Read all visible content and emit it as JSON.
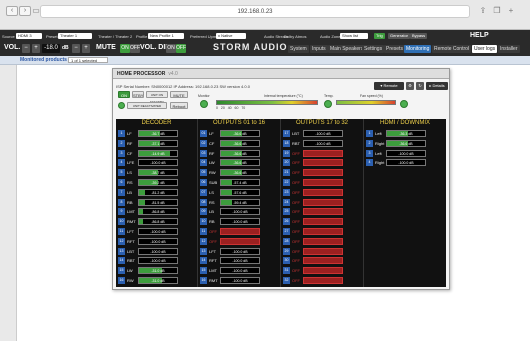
{
  "browser": {
    "url": "192.168.0.23"
  },
  "appbar": {
    "source_label": "Source",
    "source_value": "HDMI 3",
    "preset_label": "Preset",
    "preset_value": "Theater 1",
    "theater_value": "Theater / Theater 2",
    "profile_label": "Profile",
    "profile_value": "New Profile 1",
    "upmix_label": "Preferred Upmix",
    "upmix_value": "x Native",
    "audio_stream_label": "Audio Stream",
    "audio_stream_value": "Dolby Atmos",
    "audio_zones_label": "Audio Zones",
    "audio_zones_value": "Show list",
    "tag_trig": "Trig",
    "tag_generator": "Generator",
    "tag_bypass": "Bypass",
    "help": "HELP",
    "vol_label": "VOL.",
    "vol_minus": "−",
    "vol_plus": "+",
    "vol_value": "-18.0",
    "vol_unit": "dB",
    "mute_label": "MUTE",
    "mute_state": "ON",
    "mute_off": "OFF",
    "voldim_label": "VOL. DIM",
    "voldim_on": "ON",
    "voldim_off": "OFF",
    "logo": "STORM AUDIO",
    "tabs": [
      "System",
      "Inputs",
      "Main Speakers",
      "Settings",
      "Presets",
      "Monitoring",
      "Remote Control",
      "User logs",
      "Installer"
    ],
    "active_tab": "Monitoring"
  },
  "subbar": {
    "title": "Monitored products",
    "selector": "1 of 1 selected"
  },
  "panel": {
    "title": "HOME PROCESSOR",
    "version": "v4.0",
    "info": "ISP   Serial Number: SN0000012   IP Address: 192.168.0.23   SW version 4.0.0",
    "on": "ON",
    "stby": "STBY",
    "unit_on_standby": "UNIT ON STANDBY",
    "mute": "MUTE",
    "unit_deactivated": "UNIT DEACTIVATED",
    "reboot": "Reboot",
    "monitor_label": "Monitor",
    "temp_label": "Internal temperature (°C)",
    "temp_scale": [
      "0",
      "20",
      "40",
      "60",
      "70"
    ],
    "temp_status": "Temp.",
    "fan_label": "Fan speed (%)",
    "remote_value": "Remote",
    "btn_details": "Details"
  },
  "decoder": {
    "title": "DECODER",
    "channels": [
      {
        "n": "1",
        "name": "LF",
        "val": "-36.7 dB",
        "fill": 0.55,
        "on": true
      },
      {
        "n": "2",
        "name": "RF",
        "val": "-37.1 dB",
        "fill": 0.55,
        "on": true
      },
      {
        "n": "3",
        "name": "CF",
        "val": "-14.9 dB",
        "fill": 0.82,
        "on": true
      },
      {
        "n": "4",
        "name": "LFE",
        "val": "-100.0 dB",
        "fill": 0,
        "on": true
      },
      {
        "n": "5",
        "name": "LS",
        "val": "-38.7 dB",
        "fill": 0.5,
        "on": true
      },
      {
        "n": "6",
        "name": "RS",
        "val": "-39.2 dB",
        "fill": 0.5,
        "on": true
      },
      {
        "n": "7",
        "name": "LB",
        "val": "-81.2 dB",
        "fill": 0.15,
        "on": true
      },
      {
        "n": "8",
        "name": "RB",
        "val": "-81.5 dB",
        "fill": 0.15,
        "on": true
      },
      {
        "n": "9",
        "name": "LMT",
        "val": "-86.8 dB",
        "fill": 0.1,
        "on": true
      },
      {
        "n": "10",
        "name": "RMT",
        "val": "-86.8 dB",
        "fill": 0.1,
        "on": true
      },
      {
        "n": "11",
        "name": "LFT",
        "val": "-100.0 dB",
        "fill": 0,
        "on": true
      },
      {
        "n": "12",
        "name": "RFT",
        "val": "-100.0 dB",
        "fill": 0,
        "on": true
      },
      {
        "n": "13",
        "name": "LBT",
        "val": "-100.0 dB",
        "fill": 0,
        "on": true
      },
      {
        "n": "14",
        "name": "RBT",
        "val": "-100.0 dB",
        "fill": 0,
        "on": true
      },
      {
        "n": "15",
        "name": "LW",
        "val": "-31.0 dB",
        "fill": 0.6,
        "on": true
      },
      {
        "n": "16",
        "name": "RW",
        "val": "-31.0 dB",
        "fill": 0.6,
        "on": true
      }
    ]
  },
  "out1": {
    "title": "OUTPUTS 01 to 16",
    "channels": [
      {
        "n": "01",
        "name": "LF",
        "val": "-36.6 dB",
        "fill": 0.55,
        "on": true
      },
      {
        "n": "02",
        "name": "CF",
        "val": "-36.6 dB",
        "fill": 0.55,
        "on": true
      },
      {
        "n": "03",
        "name": "RF",
        "val": "-36.6 dB",
        "fill": 0.55,
        "on": true
      },
      {
        "n": "04",
        "name": "LW",
        "val": "-36.6 dB",
        "fill": 0.55,
        "on": true
      },
      {
        "n": "05",
        "name": "RW",
        "val": "-36.6 dB",
        "fill": 0.55,
        "on": true
      },
      {
        "n": "06",
        "name": "SUB",
        "val": "-57.4 dB",
        "fill": 0.3,
        "on": true
      },
      {
        "n": "07",
        "name": "LS",
        "val": "-57.6 dB",
        "fill": 0.3,
        "on": true
      },
      {
        "n": "08",
        "name": "RS",
        "val": "-59.4 dB",
        "fill": 0.28,
        "on": true
      },
      {
        "n": "09",
        "name": "LB",
        "val": "-100.0 dB",
        "fill": 0,
        "on": true
      },
      {
        "n": "10",
        "name": "RB",
        "val": "-100.0 dB",
        "fill": 0,
        "on": true
      },
      {
        "n": "11",
        "name": "OFF",
        "val": "",
        "fill": 0,
        "on": false
      },
      {
        "n": "12",
        "name": "OFF",
        "val": "",
        "fill": 0,
        "on": false
      },
      {
        "n": "13",
        "name": "LFT",
        "val": "-100.0 dB",
        "fill": 0,
        "on": true
      },
      {
        "n": "14",
        "name": "RFT",
        "val": "-100.0 dB",
        "fill": 0,
        "on": true
      },
      {
        "n": "15",
        "name": "LMT",
        "val": "-100.0 dB",
        "fill": 0,
        "on": true
      },
      {
        "n": "16",
        "name": "RMT",
        "val": "-100.0 dB",
        "fill": 0,
        "on": true
      }
    ]
  },
  "out2": {
    "title": "OUTPUTS 17 to 32",
    "channels": [
      {
        "n": "17",
        "name": "LBT",
        "val": "-100.0 dB",
        "fill": 0,
        "on": true
      },
      {
        "n": "18",
        "name": "RBT",
        "val": "-100.0 dB",
        "fill": 0,
        "on": true
      },
      {
        "n": "19",
        "name": "OFF",
        "val": "",
        "fill": 0,
        "on": false
      },
      {
        "n": "20",
        "name": "OFF",
        "val": "",
        "fill": 0,
        "on": false
      },
      {
        "n": "21",
        "name": "OFF",
        "val": "",
        "fill": 0,
        "on": false
      },
      {
        "n": "22",
        "name": "OFF",
        "val": "",
        "fill": 0,
        "on": false
      },
      {
        "n": "23",
        "name": "OFF",
        "val": "",
        "fill": 0,
        "on": false
      },
      {
        "n": "24",
        "name": "OFF",
        "val": "",
        "fill": 0,
        "on": false
      },
      {
        "n": "25",
        "name": "OFF",
        "val": "",
        "fill": 0,
        "on": false
      },
      {
        "n": "26",
        "name": "OFF",
        "val": "",
        "fill": 0,
        "on": false
      },
      {
        "n": "27",
        "name": "OFF",
        "val": "",
        "fill": 0,
        "on": false
      },
      {
        "n": "28",
        "name": "OFF",
        "val": "",
        "fill": 0,
        "on": false
      },
      {
        "n": "29",
        "name": "OFF",
        "val": "",
        "fill": 0,
        "on": false
      },
      {
        "n": "30",
        "name": "OFF",
        "val": "",
        "fill": 0,
        "on": false
      },
      {
        "n": "31",
        "name": "OFF",
        "val": "",
        "fill": 0,
        "on": false
      },
      {
        "n": "32",
        "name": "OFF",
        "val": "",
        "fill": 0,
        "on": false
      }
    ]
  },
  "hdmi": {
    "title": "HDMI / DOWNMIX",
    "channels": [
      {
        "n": "1",
        "name": "Left",
        "val": "-36.3 dB",
        "fill": 0.55,
        "on": true
      },
      {
        "n": "2",
        "name": "Right",
        "val": "-36.6 dB",
        "fill": 0.55,
        "on": true
      },
      {
        "n": "3",
        "name": "Left",
        "val": "-100.0 dB",
        "fill": 0,
        "on": true
      },
      {
        "n": "4",
        "name": "Right",
        "val": "-100.0 dB",
        "fill": 0,
        "on": true
      }
    ]
  },
  "colors": {
    "accent": "#2f6fb4",
    "ok": "#3d9d3d",
    "off": "#9c2020",
    "header": "#f0d24c"
  }
}
